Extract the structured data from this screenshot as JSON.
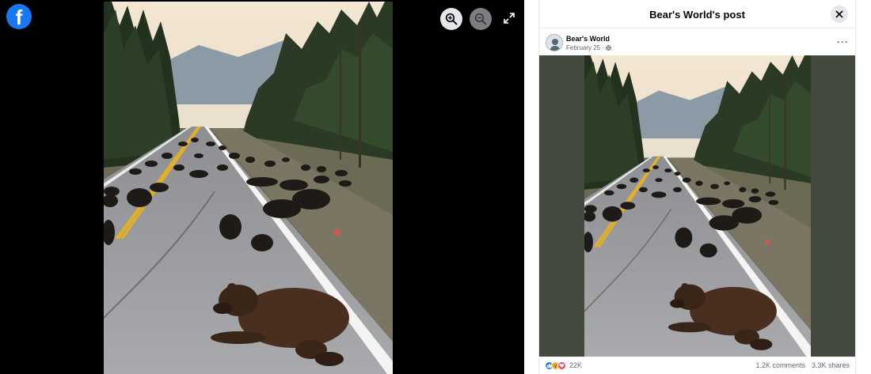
{
  "viewer": {
    "logo_letter": "f",
    "icons": {
      "logo": "facebook-logo-icon",
      "zoom_in": "zoom-in-icon",
      "zoom_out": "zoom-out-icon",
      "fullscreen": "fullscreen-icon"
    }
  },
  "panel": {
    "title": "Bear's World's post",
    "close_icon": "close-icon",
    "author": {
      "name": "Bear's World",
      "date": "February 25 · ",
      "privacy_icon": "globe-icon"
    },
    "more_label": "···",
    "reactions": {
      "icons": [
        "like-icon",
        "wow-icon",
        "love-icon"
      ],
      "count": "22K"
    },
    "comments": "1.2K comments",
    "shares": "3.3K shares"
  },
  "colors": {
    "facebook_blue": "#1877f2",
    "like": "#1877f2",
    "wow": "#f7b125",
    "love": "#f33e58",
    "viewer_bg": "#000000",
    "photo_pad": "#454a3e"
  }
}
